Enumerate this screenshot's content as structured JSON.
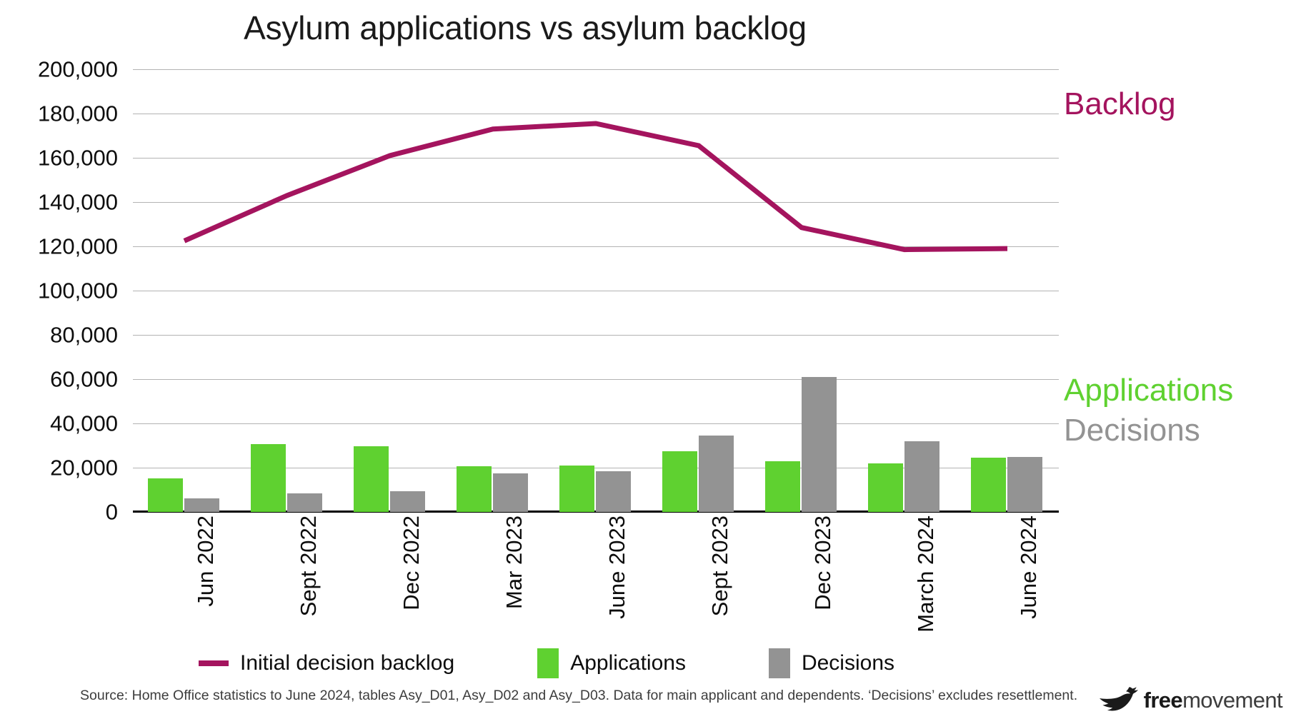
{
  "chart": {
    "title": "Asylum applications vs asylum backlog"
  },
  "callouts": {
    "backlog": "Backlog",
    "applications": "Applications",
    "decisions": "Decisions"
  },
  "legend": [
    {
      "label": "Initial decision backlog",
      "marker": "line",
      "color": "#a4145e"
    },
    {
      "label": "Applications",
      "marker": "box",
      "color": "#5fd130"
    },
    {
      "label": "Decisions",
      "marker": "box",
      "color": "#939393"
    }
  ],
  "source_note": "Source: Home Office statistics to June 2024, tables Asy_D01, Asy_D02 and Asy_D03. Data for main applicant and dependents. ‘Decisions’ excludes resettlement.",
  "logo": {
    "bird_icon": "bird-icon",
    "text_bold": "free",
    "text_regular": "movement"
  },
  "chart_data": {
    "type": "bar",
    "title": "Asylum applications vs asylum backlog",
    "xlabel": "",
    "ylabel": "",
    "ylim": [
      0,
      200000
    ],
    "ytick_values": [
      200000,
      180000,
      160000,
      140000,
      120000,
      100000,
      80000,
      60000,
      40000,
      20000,
      0
    ],
    "ytick_labels": [
      "200,000",
      "180,000",
      "160,000",
      "140,000",
      "120,000",
      "100,000",
      "80,000",
      "60,000",
      "40,000",
      "20,000",
      "0"
    ],
    "grid": true,
    "legend_position": "bottom",
    "categories": [
      "Jun 2022",
      "Sept 2022",
      "Dec 2022",
      "Mar 2023",
      "June 2023",
      "Sept 2023",
      "Dec 2023",
      "March 2024",
      "June 2024"
    ],
    "series": [
      {
        "name": "Applications",
        "type": "bar",
        "color": "#5fd130",
        "values": [
          15200,
          30800,
          29700,
          20700,
          21000,
          27300,
          22800,
          22000,
          24500
        ]
      },
      {
        "name": "Decisions",
        "type": "bar",
        "color": "#939393",
        "values": [
          6200,
          8300,
          9200,
          17400,
          18400,
          34500,
          61000,
          32100,
          25000
        ]
      },
      {
        "name": "Initial decision backlog",
        "type": "line",
        "color": "#a4145e",
        "values": [
          122500,
          143000,
          161000,
          173000,
          175500,
          165500,
          128500,
          118500,
          119000
        ]
      }
    ]
  }
}
